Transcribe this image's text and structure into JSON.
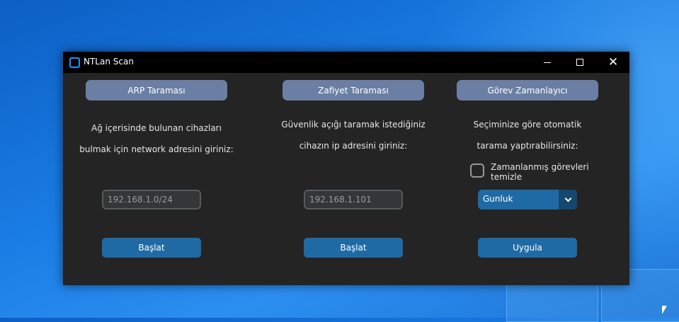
{
  "window": {
    "title": "NTLan Scan"
  },
  "controls": {
    "minimize": "minimize",
    "maximize": "maximize",
    "close": "close"
  },
  "arp": {
    "header": "ARP Taraması",
    "desc_line1": "Ağ içerisinde bulunan cihazları",
    "desc_line2": "bulmak için network adresini giriniz:",
    "input_value": "192.168.1.0/24",
    "button": "Başlat"
  },
  "vuln": {
    "header": "Zafiyet Taraması",
    "desc_line1": "Güvenlik açığı taramak istediğiniz",
    "desc_line2": "cihazın ip adresini giriniz:",
    "input_value": "192.168.1.101",
    "button": "Başlat"
  },
  "scheduler": {
    "header": "Görev Zamanlayıcı",
    "desc_line1": "Seçiminize göre otomatik",
    "desc_line2": "tarama yaptırabilirsiniz:",
    "checkbox_label": "Zamanlanmış görevleri temizle",
    "checkbox_checked": false,
    "dropdown_value": "Gunluk",
    "button": "Uygula"
  },
  "colors": {
    "window_bg": "#242424",
    "header_button": "#6b7fa5",
    "action_button": "#1f6aa5",
    "input_bg": "#343638"
  }
}
